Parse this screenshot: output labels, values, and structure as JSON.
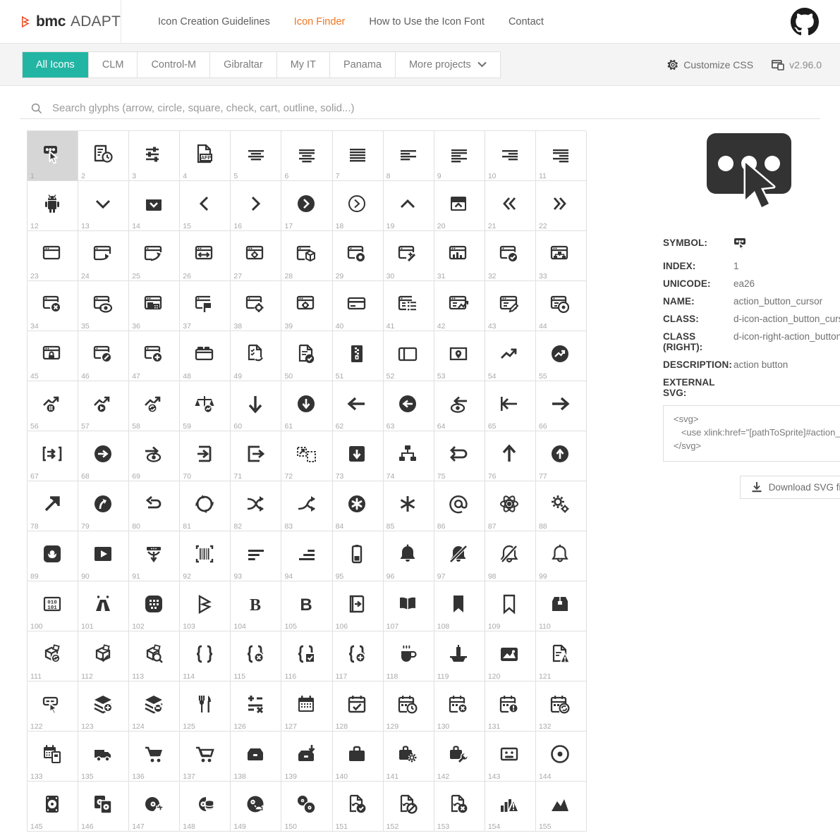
{
  "header": {
    "brand_bmc": "bmc",
    "brand_adapt": "ADAPT",
    "nav": [
      {
        "label": "Icon Creation Guidelines",
        "active": false
      },
      {
        "label": "Icon Finder",
        "active": true
      },
      {
        "label": "How to Use the Icon Font",
        "active": false
      },
      {
        "label": "Contact",
        "active": false
      }
    ],
    "github_icon": "github-icon",
    "accent_color": "#ef7622"
  },
  "subnav": {
    "tabs": [
      {
        "label": "All Icons",
        "active": true
      },
      {
        "label": "CLM",
        "active": false
      },
      {
        "label": "Control-M",
        "active": false
      },
      {
        "label": "Gibraltar",
        "active": false
      },
      {
        "label": "My IT",
        "active": false
      },
      {
        "label": "Panama",
        "active": false
      },
      {
        "label": "More projects",
        "active": false,
        "caret": true
      }
    ],
    "customize_css": "Customize CSS",
    "version": "v2.96.0",
    "active_color": "#23b5a4"
  },
  "search": {
    "placeholder": "Search glyphs (arrow, circle, square, check, cart, outline, solid...)",
    "value": ""
  },
  "grid": {
    "columns": 11,
    "selected_index": "1",
    "cells": [
      {
        "n": "1",
        "icon": "action-button-cursor-icon"
      },
      {
        "n": "2",
        "icon": "activity-log-clock-icon"
      },
      {
        "n": "3",
        "icon": "adjust-sliders-icon"
      },
      {
        "n": "4",
        "icon": "afp-document-icon"
      },
      {
        "n": "5",
        "icon": "align-center-icon"
      },
      {
        "n": "6",
        "icon": "align-center-wide-icon"
      },
      {
        "n": "7",
        "icon": "align-justify-icon"
      },
      {
        "n": "8",
        "icon": "align-left-icon"
      },
      {
        "n": "9",
        "icon": "align-left-wide-icon"
      },
      {
        "n": "10",
        "icon": "align-right-icon"
      },
      {
        "n": "11",
        "icon": "align-right-wide-icon"
      },
      {
        "n": "12",
        "icon": "android-icon"
      },
      {
        "n": "13",
        "icon": "angle-down-icon"
      },
      {
        "n": "14",
        "icon": "angle-down-box-icon"
      },
      {
        "n": "15",
        "icon": "angle-left-icon"
      },
      {
        "n": "16",
        "icon": "angle-right-icon"
      },
      {
        "n": "17",
        "icon": "angle-right-circle-filled-icon"
      },
      {
        "n": "18",
        "icon": "angle-right-circle-icon"
      },
      {
        "n": "19",
        "icon": "angle-up-icon"
      },
      {
        "n": "20",
        "icon": "angle-up-box-icon"
      },
      {
        "n": "21",
        "icon": "angle-double-left-icon"
      },
      {
        "n": "22",
        "icon": "angle-double-right-icon"
      },
      {
        "n": "23",
        "icon": "application-icon"
      },
      {
        "n": "24",
        "icon": "application-arrow-icon"
      },
      {
        "n": "25",
        "icon": "application-arrow-out-icon"
      },
      {
        "n": "26",
        "icon": "application-resize-icon"
      },
      {
        "n": "27",
        "icon": "application-settings-icon"
      },
      {
        "n": "28",
        "icon": "application-package-icon"
      },
      {
        "n": "29",
        "icon": "application-view-icon"
      },
      {
        "n": "30",
        "icon": "application-magic-icon"
      },
      {
        "n": "31",
        "icon": "application-chart-icon"
      },
      {
        "n": "32",
        "icon": "application-check-icon"
      },
      {
        "n": "33",
        "icon": "application-network-icon"
      },
      {
        "n": "34",
        "icon": "application-close-icon"
      },
      {
        "n": "35",
        "icon": "application-eye-icon"
      },
      {
        "n": "36",
        "icon": "application-building-icon"
      },
      {
        "n": "37",
        "icon": "application-flag-icon"
      },
      {
        "n": "38",
        "icon": "application-gear-icon"
      },
      {
        "n": "39",
        "icon": "application-config-icon"
      },
      {
        "n": "40",
        "icon": "application-card-icon"
      },
      {
        "n": "41",
        "icon": "application-list-icon"
      },
      {
        "n": "42",
        "icon": "application-report-icon"
      },
      {
        "n": "43",
        "icon": "application-edit-icon"
      },
      {
        "n": "44",
        "icon": "application-info-icon"
      },
      {
        "n": "45",
        "icon": "application-lock-icon"
      },
      {
        "n": "46",
        "icon": "application-block-icon"
      },
      {
        "n": "47",
        "icon": "application-add-icon"
      },
      {
        "n": "48",
        "icon": "application-tabs-icon"
      },
      {
        "n": "49",
        "icon": "document-sync-icon"
      },
      {
        "n": "50",
        "icon": "document-check-icon"
      },
      {
        "n": "51",
        "icon": "archive-zip-icon"
      },
      {
        "n": "52",
        "icon": "panel-left-icon"
      },
      {
        "n": "53",
        "icon": "area-location-icon"
      },
      {
        "n": "54",
        "icon": "trend-up-icon"
      },
      {
        "n": "55",
        "icon": "trend-up-circle-icon"
      },
      {
        "n": "56",
        "icon": "trend-pause-icon"
      },
      {
        "n": "57",
        "icon": "trend-play-icon"
      },
      {
        "n": "58",
        "icon": "trend-refresh-icon"
      },
      {
        "n": "59",
        "icon": "balance-trend-icon"
      },
      {
        "n": "60",
        "icon": "arrow-down-icon"
      },
      {
        "n": "61",
        "icon": "arrow-down-circle-icon"
      },
      {
        "n": "62",
        "icon": "arrow-left-icon"
      },
      {
        "n": "63",
        "icon": "arrow-left-circle-icon"
      },
      {
        "n": "64",
        "icon": "arrow-left-eye-icon"
      },
      {
        "n": "65",
        "icon": "arrow-left-bar-icon"
      },
      {
        "n": "66",
        "icon": "arrow-right-icon"
      },
      {
        "n": "67",
        "icon": "arrow-forward-box-icon"
      },
      {
        "n": "68",
        "icon": "arrow-right-circle-icon"
      },
      {
        "n": "69",
        "icon": "arrow-right-eye-icon"
      },
      {
        "n": "70",
        "icon": "arrow-enter-icon"
      },
      {
        "n": "71",
        "icon": "arrow-exit-icon"
      },
      {
        "n": "72",
        "icon": "arrow-collapse-icon"
      },
      {
        "n": "73",
        "icon": "arrow-down-filled-icon"
      },
      {
        "n": "74",
        "icon": "hierarchy-icon"
      },
      {
        "n": "75",
        "icon": "arrow-loop-icon"
      },
      {
        "n": "76",
        "icon": "arrow-up-icon"
      },
      {
        "n": "77",
        "icon": "arrow-up-circle-icon"
      },
      {
        "n": "78",
        "icon": "arrow-up-right-icon"
      },
      {
        "n": "79",
        "icon": "arrow-curve-circle-icon"
      },
      {
        "n": "80",
        "icon": "arrow-return-icon"
      },
      {
        "n": "81",
        "icon": "arrows-rotate-icon"
      },
      {
        "n": "82",
        "icon": "arrows-cross-icon"
      },
      {
        "n": "83",
        "icon": "arrows-shuffle-icon"
      },
      {
        "n": "84",
        "icon": "asterisk-circle-icon"
      },
      {
        "n": "85",
        "icon": "asterisk-icon"
      },
      {
        "n": "86",
        "icon": "at-sign-icon"
      },
      {
        "n": "87",
        "icon": "atom-icon"
      },
      {
        "n": "88",
        "icon": "gears-icon"
      },
      {
        "n": "89",
        "icon": "flower-square-icon"
      },
      {
        "n": "90",
        "icon": "play-square-icon"
      },
      {
        "n": "91",
        "icon": "distribute-down-icon"
      },
      {
        "n": "92",
        "icon": "barcode-icon"
      },
      {
        "n": "93",
        "icon": "bars-descending-icon"
      },
      {
        "n": "94",
        "icon": "bars-ascending-icon"
      },
      {
        "n": "95",
        "icon": "battery-icon"
      },
      {
        "n": "96",
        "icon": "bell-icon"
      },
      {
        "n": "97",
        "icon": "bell-off-icon"
      },
      {
        "n": "98",
        "icon": "bell-slash-icon"
      },
      {
        "n": "99",
        "icon": "bell-outline-icon"
      },
      {
        "n": "100",
        "icon": "binary-icon"
      },
      {
        "n": "101",
        "icon": "binoculars-icon"
      },
      {
        "n": "102",
        "icon": "blackberry-icon"
      },
      {
        "n": "103",
        "icon": "bmc-logo-icon"
      },
      {
        "n": "104",
        "icon": "bold-serif-icon"
      },
      {
        "n": "105",
        "icon": "bold-icon"
      },
      {
        "n": "106",
        "icon": "book-arrow-icon"
      },
      {
        "n": "107",
        "icon": "book-open-icon"
      },
      {
        "n": "108",
        "icon": "bookmark-filled-icon"
      },
      {
        "n": "109",
        "icon": "bookmark-outline-icon"
      },
      {
        "n": "110",
        "icon": "box-open-icon"
      },
      {
        "n": "111",
        "icon": "box-sync-icon"
      },
      {
        "n": "112",
        "icon": "box-check-icon"
      },
      {
        "n": "113",
        "icon": "box-search-icon"
      },
      {
        "n": "114",
        "icon": "braces-icon"
      },
      {
        "n": "115",
        "icon": "braces-close-icon"
      },
      {
        "n": "116",
        "icon": "braces-check-icon"
      },
      {
        "n": "117",
        "icon": "braces-add-icon"
      },
      {
        "n": "118",
        "icon": "coffee-icon"
      },
      {
        "n": "119",
        "icon": "fountain-icon"
      },
      {
        "n": "120",
        "icon": "image-chart-icon"
      },
      {
        "n": "121",
        "icon": "document-alert-icon"
      },
      {
        "n": "122",
        "icon": "button-cursor-icon"
      },
      {
        "n": "123",
        "icon": "layers-add-icon"
      },
      {
        "n": "124",
        "icon": "layers-alert-icon"
      },
      {
        "n": "125",
        "icon": "cutlery-icon"
      },
      {
        "n": "126",
        "icon": "calculator-icon"
      },
      {
        "n": "127",
        "icon": "calendar-icon"
      },
      {
        "n": "128",
        "icon": "calendar-check-icon"
      },
      {
        "n": "129",
        "icon": "calendar-clock-icon"
      },
      {
        "n": "130",
        "icon": "calendar-close-icon"
      },
      {
        "n": "131",
        "icon": "calendar-alert-icon"
      },
      {
        "n": "132",
        "icon": "calendar-refresh-icon"
      },
      {
        "n": "133",
        "icon": "calendar-note-icon"
      },
      {
        "n": "135",
        "icon": "truck-icon"
      },
      {
        "n": "136",
        "icon": "cart-filled-icon"
      },
      {
        "n": "137",
        "icon": "cart-outline-icon"
      },
      {
        "n": "138",
        "icon": "case-icon"
      },
      {
        "n": "139",
        "icon": "case-download-icon"
      },
      {
        "n": "140",
        "icon": "briefcase-icon"
      },
      {
        "n": "141",
        "icon": "briefcase-gear-icon"
      },
      {
        "n": "142",
        "icon": "briefcase-wrench-icon"
      },
      {
        "n": "143",
        "icon": "cassette-icon"
      },
      {
        "n": "144",
        "icon": "cd-icon"
      },
      {
        "n": "145",
        "icon": "disk-icon"
      },
      {
        "n": "146",
        "icon": "disks-icon"
      },
      {
        "n": "147",
        "icon": "disk-puzzle-icon"
      },
      {
        "n": "148",
        "icon": "disk-database-icon"
      },
      {
        "n": "149",
        "icon": "disk-alert-icon"
      },
      {
        "n": "150",
        "icon": "disks-small-icon"
      },
      {
        "n": "151",
        "icon": "document-restore-check-icon"
      },
      {
        "n": "152",
        "icon": "document-restore-block-icon"
      },
      {
        "n": "153",
        "icon": "document-restore-close-icon"
      },
      {
        "n": "154",
        "icon": "chart-alert-icon"
      },
      {
        "n": "155",
        "icon": "mountain-chart-icon"
      }
    ]
  },
  "detail": {
    "preview_icon": "action-button-cursor-icon",
    "rows": [
      {
        "label": "SYMBOL:",
        "value": "",
        "is_symbol": true
      },
      {
        "label": "INDEX:",
        "value": "1"
      },
      {
        "label": "UNICODE:",
        "value": "ea26"
      },
      {
        "label": "NAME:",
        "value": "action_button_cursor"
      },
      {
        "label": "CLASS:",
        "value": "d-icon-action_button_cursor"
      },
      {
        "label": "CLASS (RIGHT):",
        "value": "d-icon-right-action_button_cursor"
      },
      {
        "label": "DESCRIPTION:",
        "value": "action button"
      }
    ],
    "external_svg_label": "EXTERNAL SVG:",
    "external_svg_code": "<svg>\n   <use xlink:href=\"[pathToSprite]#action_b\n</svg>",
    "download_label": "Download SVG file"
  }
}
